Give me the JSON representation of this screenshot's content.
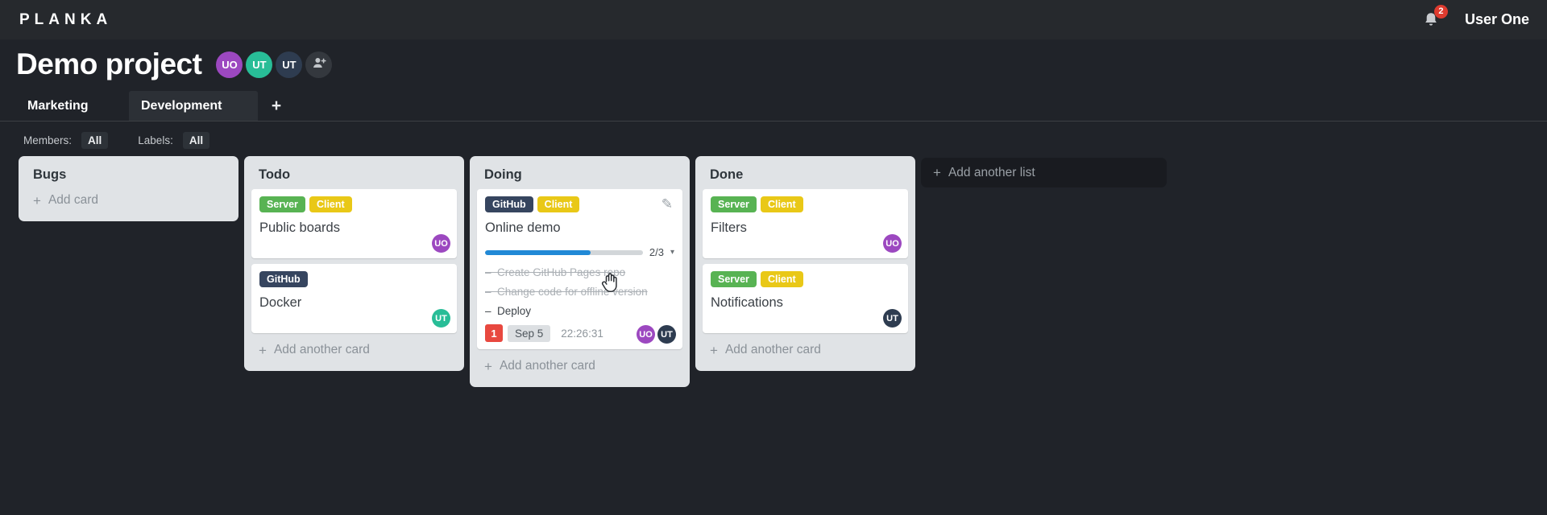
{
  "theme": {
    "topbar_bg": "#26292d",
    "board_bg": "#202329",
    "active_tab_bg": "#2c3036",
    "list_bg": "#e0e3e6",
    "card_bg": "#ffffff",
    "progress_blue": "#2189d6",
    "notification_red": "#e8483f",
    "label_green": "#58b353",
    "label_yellow": "#e9c817",
    "label_navy": "#36455f",
    "avatar_purple": "#9c48c0",
    "avatar_teal": "#28bd97",
    "avatar_navy": "#2e3c50"
  },
  "icons": {
    "plus": "+",
    "caret_down": "▾",
    "pencil": "✎"
  },
  "topbar": {
    "logo": "PLANKA",
    "notification_count": "2",
    "user_name": "User One"
  },
  "project": {
    "title": "Demo project",
    "members": [
      {
        "initials": "UO",
        "color": "purple"
      },
      {
        "initials": "UT",
        "color": "teal"
      },
      {
        "initials": "UT",
        "color": "navy"
      }
    ]
  },
  "tabs": {
    "items": [
      {
        "label": "Marketing",
        "active": false
      },
      {
        "label": "Development",
        "active": true
      }
    ]
  },
  "filters": {
    "members_label": "Members:",
    "members_value": "All",
    "labels_label": "Labels:",
    "labels_value": "All"
  },
  "board": {
    "add_list_label": "Add another list",
    "lists": [
      {
        "title": "Bugs",
        "add_card_label": "Add card",
        "cards": []
      },
      {
        "title": "Todo",
        "add_card_label": "Add another card",
        "cards": [
          {
            "title": "Public boards",
            "labels": [
              {
                "text": "Server",
                "color": "green"
              },
              {
                "text": "Client",
                "color": "yellow"
              }
            ],
            "assignees": [
              {
                "initials": "UO",
                "color": "purple"
              }
            ]
          },
          {
            "title": "Docker",
            "labels": [
              {
                "text": "GitHub",
                "color": "navy"
              }
            ],
            "assignees": [
              {
                "initials": "UT",
                "color": "teal"
              }
            ]
          }
        ]
      },
      {
        "title": "Doing",
        "add_card_label": "Add another card",
        "cards": [
          {
            "title": "Online demo",
            "labels": [
              {
                "text": "GitHub",
                "color": "navy"
              },
              {
                "text": "Client",
                "color": "yellow"
              }
            ],
            "progress": {
              "completed": 2,
              "total": 3,
              "percent": 66.7,
              "text": "2/3"
            },
            "tasks": [
              {
                "text": "Create GitHub Pages repo",
                "done": true
              },
              {
                "text": "Change code for offline version",
                "done": true
              },
              {
                "text": "Deploy",
                "done": false
              }
            ],
            "notification_count": "1",
            "due_date": "Sep 5",
            "timer": "22:26:31",
            "assignees": [
              {
                "initials": "UO",
                "color": "purple"
              },
              {
                "initials": "UT",
                "color": "navy"
              }
            ]
          }
        ]
      },
      {
        "title": "Done",
        "add_card_label": "Add another card",
        "cards": [
          {
            "title": "Filters",
            "labels": [
              {
                "text": "Server",
                "color": "green"
              },
              {
                "text": "Client",
                "color": "yellow"
              }
            ],
            "assignees": [
              {
                "initials": "UO",
                "color": "purple"
              }
            ]
          },
          {
            "title": "Notifications",
            "labels": [
              {
                "text": "Server",
                "color": "green"
              },
              {
                "text": "Client",
                "color": "yellow"
              }
            ],
            "assignees": [
              {
                "initials": "UT",
                "color": "navy"
              }
            ]
          }
        ]
      }
    ]
  }
}
